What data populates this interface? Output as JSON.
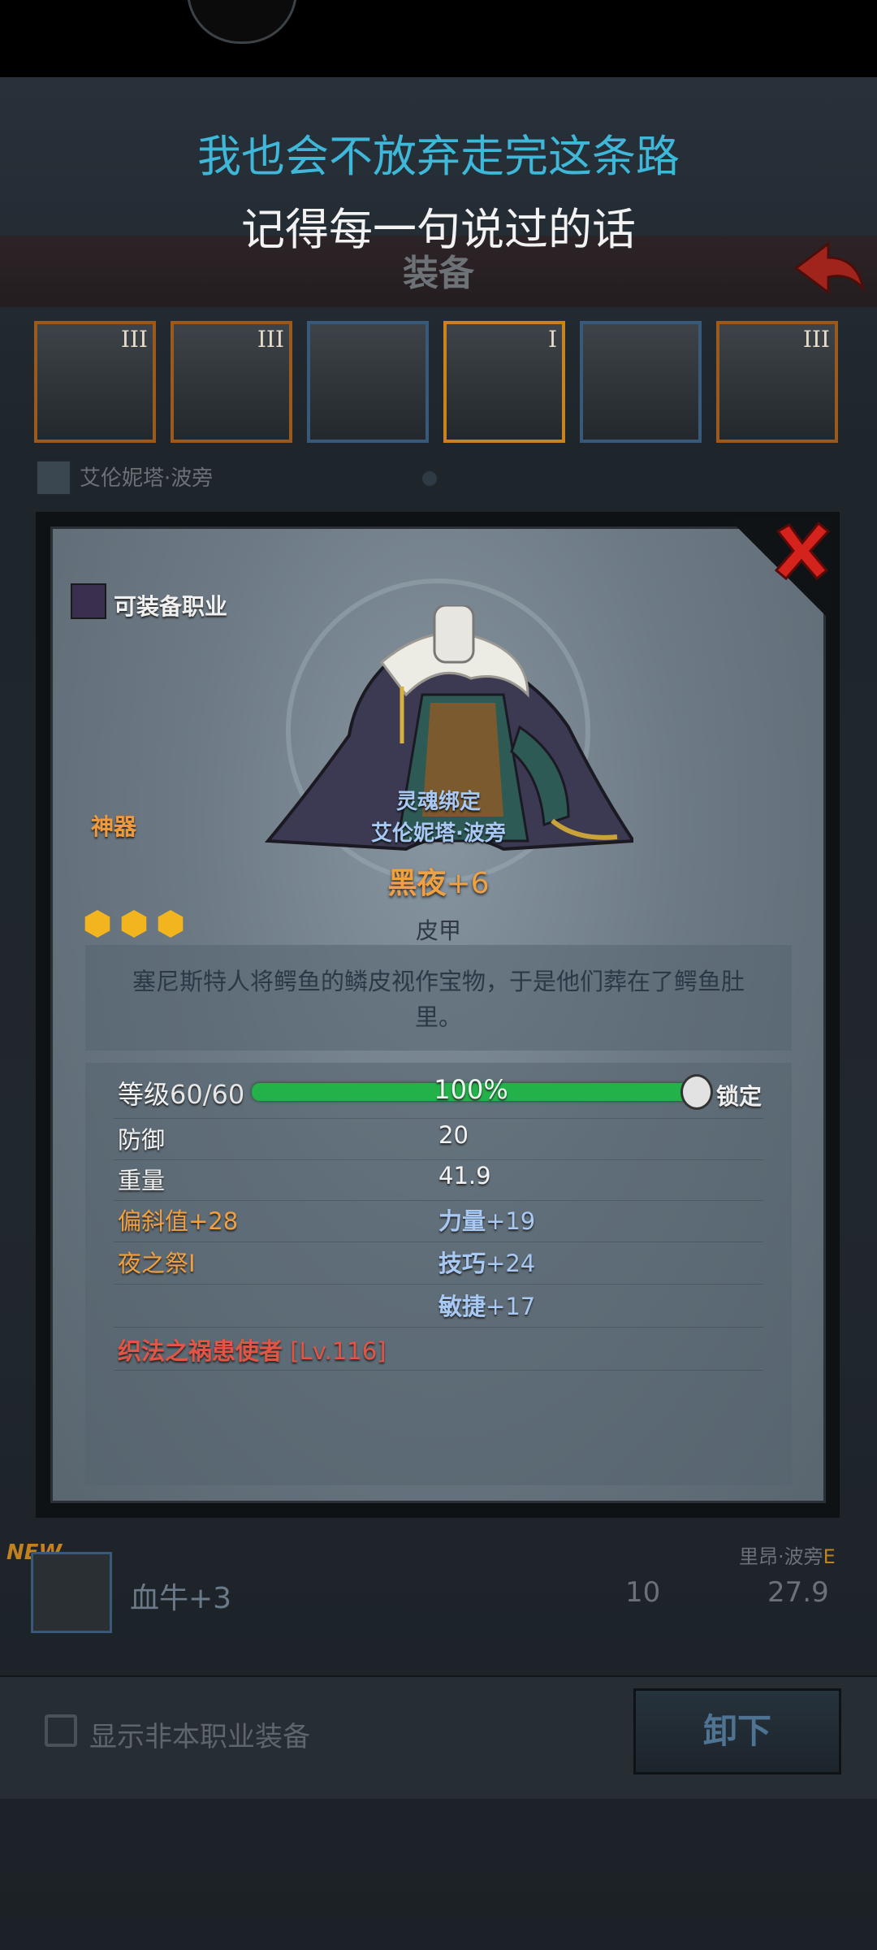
{
  "lyrics": {
    "line1": "我也会不放弃走完这条路",
    "line2": "记得每一句说过的话"
  },
  "screen": {
    "title": "装备",
    "slots": [
      {
        "roman": "III"
      },
      {
        "roman": "III"
      },
      {
        "roman": ""
      },
      {
        "roman": "I"
      },
      {
        "roman": ""
      },
      {
        "roman": "III"
      }
    ],
    "owner": "艾伦妮塔·波旁"
  },
  "list_item": {
    "new_tag": "NEW",
    "name": "血牛+3",
    "owner": "里昂·波旁",
    "grade": "E",
    "defense": "10",
    "weight": "27.9"
  },
  "footer": {
    "show_other_label": "显示非本职业装备",
    "unequip_label": "卸下"
  },
  "item": {
    "class_label": "可装备职业",
    "rarity": "神器",
    "soulbound": "灵魂绑定",
    "bound_owner": "艾伦妮塔·波旁",
    "name": "黑夜",
    "plus": "+6",
    "stars": 3,
    "type": "皮甲",
    "description": "塞尼斯特人将鳄鱼的鳞皮视作宝物，于是他们葬在了鳄鱼肚里。",
    "level_label": "等级",
    "level_value": "60/60",
    "progress_text": "100%",
    "progress": 1.0,
    "lock_label": "锁定",
    "stats": {
      "defense_label": "防御",
      "defense_value": "20",
      "weight_label": "重量",
      "weight_value": "41.9",
      "deflect": "偏斜值+28",
      "strength_label": "力量",
      "strength_value": "+19",
      "skill": "夜之祭I",
      "technique_label": "技巧",
      "technique_value": "+24",
      "agility_label": "敏捷",
      "agility_value": "+17",
      "set_name": "织法之祸患使者",
      "set_level": "[Lv.116]"
    }
  },
  "colors": {
    "lyric_accent": "#3fb7d8",
    "rarity_orange": "#f0a040",
    "stat_blue": "#a9c9f5",
    "xp_green": "#23b24a",
    "set_red": "#e25545"
  }
}
